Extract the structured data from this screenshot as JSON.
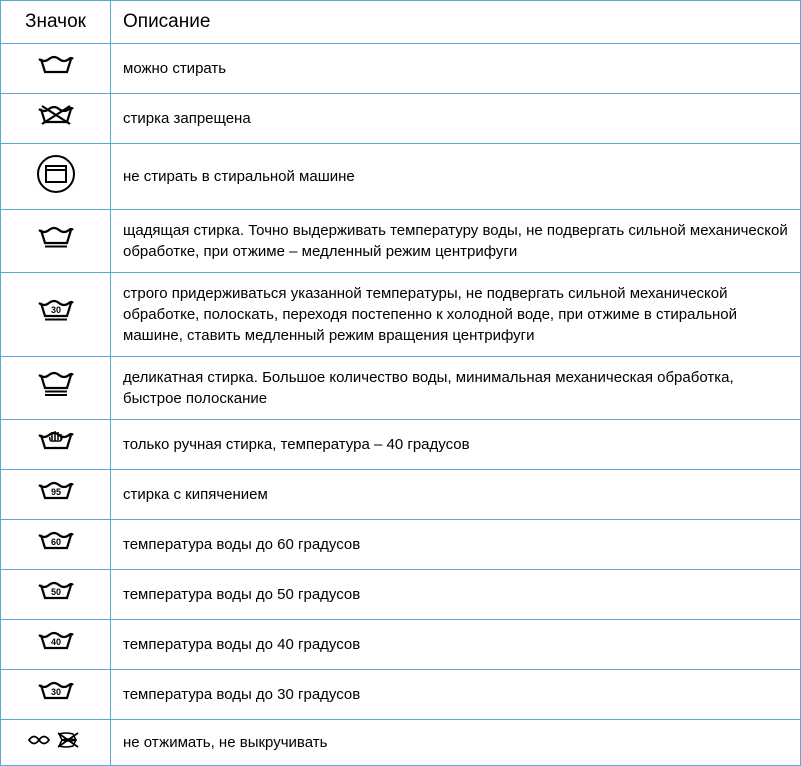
{
  "headers": {
    "icon": "Значок",
    "description": "Описание"
  },
  "rows": [
    {
      "icon": "wash",
      "text": "можно стирать"
    },
    {
      "icon": "wash-no",
      "text": "стирка запрещена"
    },
    {
      "icon": "no-machine-circle",
      "text": "не стирать в стиральной машине"
    },
    {
      "icon": "wash-1bar",
      "text": "щадящая стирка. Точно выдерживать температуру воды, не подвергать сильной механической обработке, при отжиме – медленный режим центрифуги"
    },
    {
      "icon": "wash-30-1bar",
      "text": "строго придерживаться указанной температуры, не подвергать сильной механической обработке, полоскать, переходя постепенно к холодной воде, при отжиме в стиральной машине, ставить медленный режим вращения центрифуги"
    },
    {
      "icon": "wash-2bar",
      "text": "деликатная стирка. Большое количество воды, минимальная механическая обработка, быстрое полоскание"
    },
    {
      "icon": "wash-hand",
      "text": "только ручная стирка, температура – 40 градусов"
    },
    {
      "icon": "wash-95",
      "text": "стирка с кипячением"
    },
    {
      "icon": "wash-60",
      "text": "температура воды до 60 градусов"
    },
    {
      "icon": "wash-50",
      "text": "температура воды до 50 градусов"
    },
    {
      "icon": "wash-40",
      "text": "температура воды до 40 градусов"
    },
    {
      "icon": "wash-30",
      "text": "температура воды до 30 градусов"
    },
    {
      "icon": "no-wring",
      "text": "не отжимать, не выкручивать"
    }
  ]
}
